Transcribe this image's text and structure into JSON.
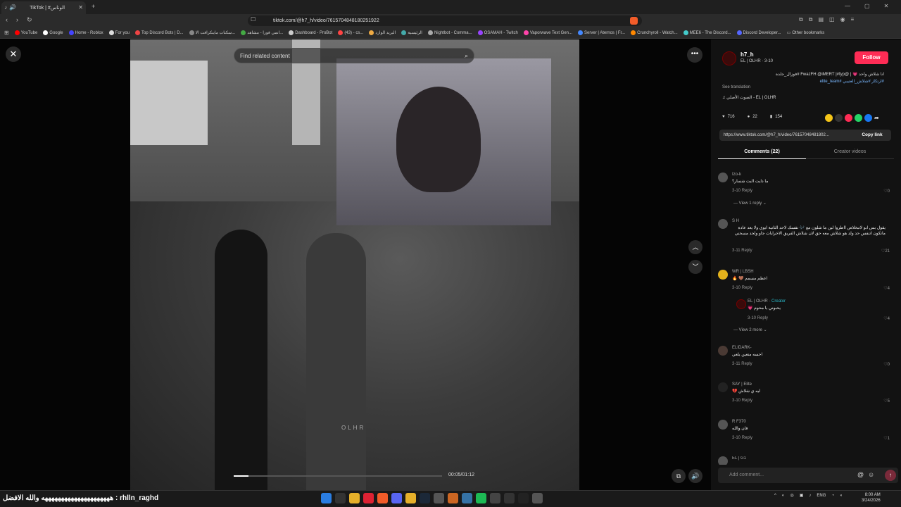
{
  "browser": {
    "tab_title": "TikTok | #الوناس",
    "new_tab_icon": "plus-icon",
    "url": "tiktok.com/@h7_h/video/7615704848180251922",
    "bookmarks": [
      "YouTube",
      "Google",
      "Home - Roblox",
      "For you",
      "Top Discord Bots | D...",
      "سكنات ماينكرافت الا...",
      "انمي فورا - مشاهد...",
      "Dashboard - ProBot",
      "(43) - cs...",
      "البريد الوارد",
      "الرئيسية",
      "Nightbot - Comma...",
      "OSAMAH - Twitch",
      "Vaporwave Text Gen...",
      "Server | Aternos | Fr...",
      "Crunchyroll - Watch...",
      "MEE6 - The Discord...",
      "Discord Developer...",
      "Other bookmarks"
    ]
  },
  "viewer": {
    "search_placeholder": "Find related content",
    "watermark": "OLHR",
    "time": "00:05/01:12",
    "progress": 0.07
  },
  "panel": {
    "username": "h7_h",
    "subline": "EL | OLHR · 3-10",
    "follow_label": "Follow",
    "desc_text": "انا شلاش واحد 💗 | @FwazFH @iMERT |#fyp #فوزال_جلدة",
    "desc_tags": "#ارتكاز #شلاش_العتيبي #elite_team",
    "see_translation": "See translation",
    "music": "الصوت الأصلي - EL | OLHR",
    "likes": "716",
    "comments_count": "22",
    "saves": "154",
    "link": "https://www.tiktok.com/@h7_h/video/76157048481802...",
    "copy_label": "Copy link",
    "tab_comments": "Comments (22)",
    "tab_creator": "Creator videos",
    "add_comment_placeholder": "Add comment..."
  },
  "comments": [
    {
      "name": "Izo-k",
      "text": "ما دايت البت شسار؟",
      "date": "3-10",
      "reply": "Reply",
      "likes": "0",
      "view": "View 1 reply"
    },
    {
      "name": "S H",
      "text": "يقول بس ابو لاتبخلاص ااطروا لين ما شلون مع 🎶 نفسك لاحد الثانية ابوي ولا يعد عادة ماتكون اتنفس حد ولد هو شلاش معه حق لان شلاش الفريق الاخرايات جاو ولحد مسحني",
      "date": "3-11",
      "reply": "Reply",
      "likes": "21"
    },
    {
      "name": "WR | LBSH",
      "text": "اعظم مسمم 🤎 🔥",
      "date": "3-10",
      "reply": "Reply",
      "likes": "4"
    },
    {
      "name": "EL | OLHR",
      "creator": "Creator",
      "text": "يحبوني يا محوم 💗",
      "date": "3-10",
      "reply": "Reply",
      "likes": "4",
      "view": "View 2 more"
    },
    {
      "name": "ELIDARK-",
      "text": "احسه متعين يلعي",
      "date": "3-11",
      "reply": "Reply",
      "likes": "0"
    },
    {
      "name": "SAY | Elite",
      "text": "ليه ي شلاش 💔",
      "date": "3-10",
      "reply": "Reply",
      "likes": "5"
    },
    {
      "name": "R F370",
      "text": "فان والله",
      "date": "3-10",
      "reply": "Reply",
      "likes": "1"
    },
    {
      "name": "EL | G1",
      "text": "",
      "date": "",
      "reply": "",
      "likes": ""
    }
  ],
  "taskbar": {
    "text": "rhlln_raghd : هههههههههههههههههههههه والله الافضل",
    "lang": "ENG",
    "time": "8:00 AM",
    "date": "3/24/2026"
  },
  "colors": {
    "follow": "#fe2c55",
    "creator": "#2bb9c9",
    "tag": "#7ab8ff"
  }
}
